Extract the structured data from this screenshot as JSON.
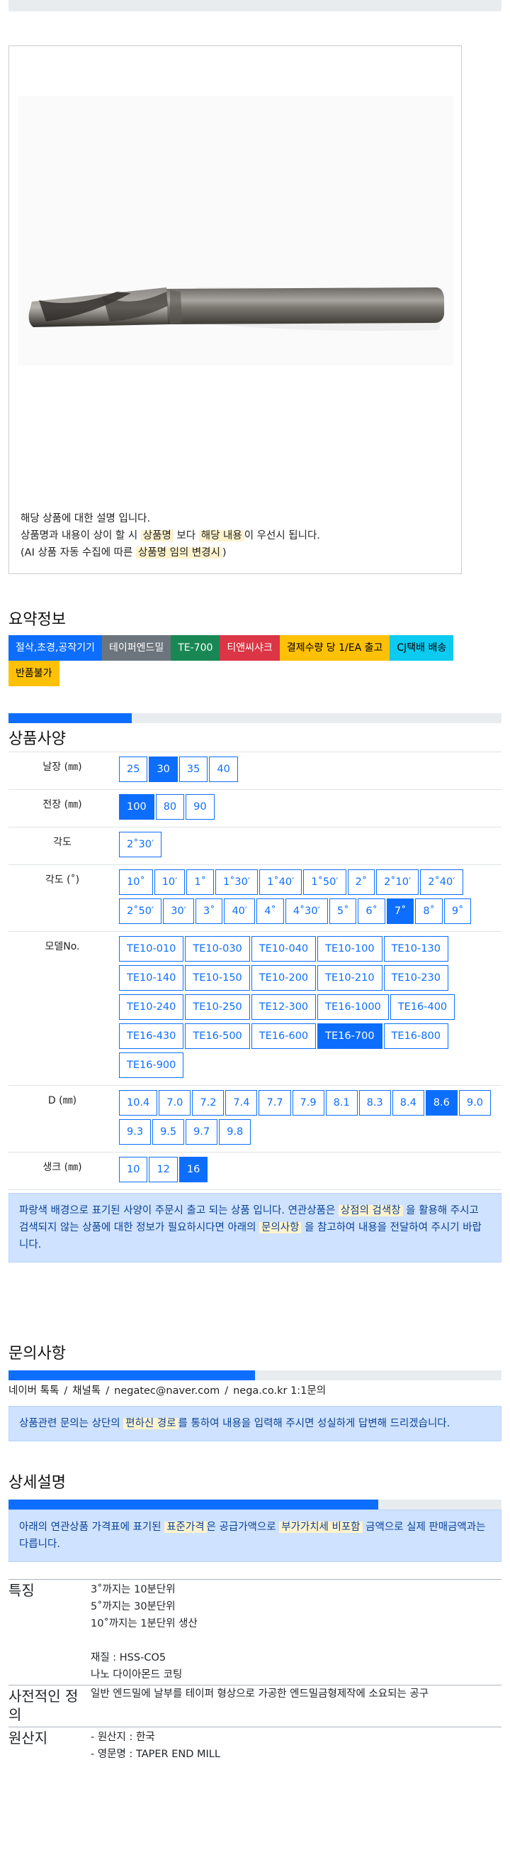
{
  "product_image": {
    "desc_line1": "해당 상품에 대한 설명 입니다.",
    "desc_line2_a": "상품명과 내용이 상이 할 시 ",
    "desc_line2_hl1": "상품명",
    "desc_line2_b": " 보다 ",
    "desc_line2_hl2": "해당 내용",
    "desc_line2_c": "이 우선시 됩니다.",
    "desc_line3_a": "(AI 상품 자동 수집에 따른 ",
    "desc_line3_hl": "상품명 임의 변경시",
    "desc_line3_b": ")"
  },
  "summary": {
    "title": "요약정보",
    "badges": [
      {
        "label": "절삭,초경,공작기기",
        "bg": "#0d6efd",
        "fg": "#ffffff"
      },
      {
        "label": "테이퍼엔드밀",
        "bg": "#6c757d",
        "fg": "#ffffff"
      },
      {
        "label": "TE-700",
        "bg": "#198754",
        "fg": "#ffffff"
      },
      {
        "label": "티앤씨샤크",
        "bg": "#dc3545",
        "fg": "#ffffff"
      },
      {
        "label": "결제수량 당 1/EA 출고",
        "bg": "#ffc107",
        "fg": "#000000"
      },
      {
        "label": "CJ택배 배송",
        "bg": "#0dcaf0",
        "fg": "#000000"
      },
      {
        "label": "반품불가",
        "bg": "#ffc107",
        "fg": "#000000"
      }
    ]
  },
  "specs": {
    "title": "상품사양",
    "progress": 0.25,
    "rows": [
      {
        "label": "날장 (㎜)",
        "options": [
          "25",
          "30",
          "35",
          "40"
        ],
        "selected": "30"
      },
      {
        "label": "전장 (㎜)",
        "options": [
          "100",
          "80",
          "90"
        ],
        "selected": "100"
      },
      {
        "label": "각도",
        "options": [
          "2˚30′"
        ],
        "selected": ""
      },
      {
        "label": "각도 (˚)",
        "options": [
          "10˚",
          "10′",
          "1˚",
          "1˚30′",
          "1˚40′",
          "1˚50′",
          "2˚",
          "2˚10′",
          "2˚40′",
          "2˚50′",
          "30′",
          "3˚",
          "40′",
          "4˚",
          "4˚30′",
          "5˚",
          "6˚",
          "7˚",
          "8˚",
          "9˚"
        ],
        "selected": "7˚"
      },
      {
        "label": "모델No.",
        "options": [
          "TE10-010",
          "TE10-030",
          "TE10-040",
          "TE10-100",
          "TE10-130",
          "TE10-140",
          "TE10-150",
          "TE10-200",
          "TE10-210",
          "TE10-230",
          "TE10-240",
          "TE10-250",
          "TE12-300",
          "TE16-1000",
          "TE16-400",
          "TE16-430",
          "TE16-500",
          "TE16-600",
          "TE16-700",
          "TE16-800",
          "TE16-900"
        ],
        "selected": "TE16-700"
      },
      {
        "label": "D (㎜)",
        "options": [
          "10.4",
          "7.0",
          "7.2",
          "7.4",
          "7.7",
          "7.9",
          "8.1",
          "8.3",
          "8.4",
          "8.6",
          "9.0",
          "9.3",
          "9.5",
          "9.7",
          "9.8"
        ],
        "selected": "8.6"
      },
      {
        "label": "생크 (㎜)",
        "options": [
          "10",
          "12",
          "16"
        ],
        "selected": "16"
      }
    ],
    "note_a": "파랑색 배경으로 표기된 사양이 주문시 출고 되는 상품 입니다. 연관상품은 ",
    "note_hl1": "상점의 검색창",
    "note_b": " 을 활용해 주시고 검색되지 않는 상품에 대한 정보가 필요하시다면 아래의 ",
    "note_hl2": "문의사항",
    "note_c": " 을 참고하여 내용을 전달하여 주시기 바랍니다."
  },
  "inquiry": {
    "title": "문의사항",
    "progress": 0.5,
    "contacts": [
      "네이버 톡톡",
      "채널톡",
      "negatec@naver.com",
      "nega.co.kr 1:1문의"
    ],
    "separator": "/",
    "note_a": "상품관련 문의는 상단의 ",
    "note_hl": "편하신 경로",
    "note_b": "를 통하여 내용을 입력해 주시면 성실하게 답변해 드리겠습니다."
  },
  "detail": {
    "title": "상세설명",
    "progress": 0.75,
    "note_a": "아래의 연관상품 가격표에 표기된 ",
    "note_hl1": "표준가격",
    "note_b": "은 공급가액으로 ",
    "note_hl2": "부가가치세 비포함",
    "note_c": " 금액으로 실제 판매금액과는 다릅니다.",
    "features": {
      "heading": "특징",
      "lines": [
        "3˚까지는 10분단위",
        "5˚까지는 30분단위",
        "10˚까지는 1분단위 생산",
        "",
        "재질 : HSS-CO5",
        "나노 다이아몬드 코팅"
      ]
    },
    "definition": {
      "heading": "사전적인 정의",
      "text": "일반 엔드밀에 날부를 테이퍼 형상으로 가공한 엔드밀금형제작에 소요되는 공구"
    },
    "origin": {
      "heading": "원산지",
      "lines": [
        "- 원산지 : 한국",
        "- 영문명 : TAPER END MILL"
      ]
    }
  }
}
